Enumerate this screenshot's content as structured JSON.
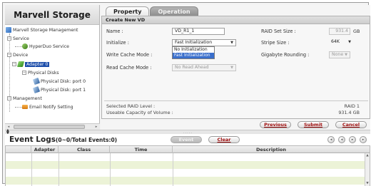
{
  "app": {
    "title": "Marvell Storage"
  },
  "tree": {
    "root": "Marvell Storage Management",
    "service_group": "Service",
    "service_item": "HyperDuo Service",
    "device_group": "Device",
    "adapter": "Adapter 0",
    "physical_disks": "Physical Disks",
    "disk_1": "Physical Disk: port 0",
    "disk_2": "Physical Disk: port 1",
    "management_group": "Management",
    "email_notify": "Email Notify Setting"
  },
  "tabs": {
    "property": "Property",
    "operation": "Operation"
  },
  "create_vd": {
    "header": "Create New VD",
    "name_label": "Name :",
    "name_value": "VD_R1_1",
    "initialize_label": "Initialize :",
    "initialize_value": "Fast Initialization",
    "initialize_options": [
      "No Initialization",
      "Fast Initialization"
    ],
    "write_cache_label": "Write Cache Mode :",
    "read_cache_label": "Read Cache Mode :",
    "read_cache_value": "No Read Ahead",
    "raid_set_size_label": "RAID Set Size :",
    "raid_set_size_value": "931.4",
    "raid_set_size_unit": "GB",
    "stripe_size_label": "Stripe Size :",
    "stripe_size_value": "64K",
    "gigabyte_rounding_label": "Gigabyte Rounding :",
    "gigabyte_rounding_value": "None"
  },
  "summary": {
    "raid_level_label": "Selected RAID Level :",
    "raid_level_value": "RAID 1",
    "capacity_label": "Useable Capacity of Volume :",
    "capacity_value": "931.4 GB"
  },
  "buttons": {
    "previous": "Previous",
    "submit": "Submit",
    "cancel": "Cancel",
    "event_left": "Event",
    "clear": "Clear"
  },
  "event_log": {
    "title": "Event Logs",
    "count": "(0~0/Total Events:0)",
    "columns": [
      "Adapter",
      "Class",
      "Time",
      "Description"
    ]
  },
  "colors": {
    "selected_node": "#1d4eaa",
    "button_text": "#a01010",
    "log_row_alt": "#ecf3d7"
  }
}
